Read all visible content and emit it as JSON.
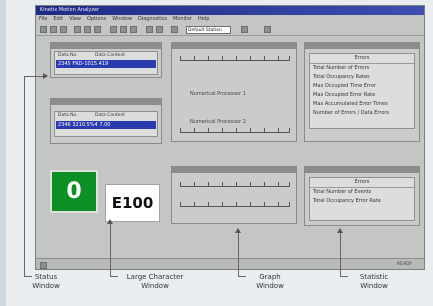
{
  "window": {
    "title": "Kinetix Motion Analyzer"
  },
  "menu": [
    "File",
    "Edit",
    "View",
    "Options",
    "Window",
    "Diagnostics",
    "Monitor",
    "Help"
  ],
  "toolbar": {
    "field_value": "Default Station"
  },
  "status_windows": [
    {
      "col1": "Data No.",
      "col2": "Data Content",
      "row": "2345  FRD-1015.419"
    },
    {
      "col1": "Data No.",
      "col2": "Data Content",
      "row": "2346  3210.5%4  7.00"
    }
  ],
  "graph_windows": [
    {
      "label_top": "Numerical Processor 1",
      "label_bottom": "Numerical Processor 2"
    }
  ],
  "statistics_top": {
    "header": "Errors",
    "items": [
      "Total Number of Errors",
      "Total Occupancy Rates",
      "Max Occupied Time Error",
      "Max Occupied Error Rate",
      "Max Accumulated Error Times",
      "Number of Errors / Data Errors"
    ]
  },
  "statistics_bottom": {
    "header": "Errors",
    "items": [
      "Total Number of Events",
      "Total Occupancy Error Rate"
    ]
  },
  "large_numeric": {
    "value": "0"
  },
  "large_character": {
    "value": "E100"
  },
  "status_bar": {
    "text": "READY"
  },
  "captions": {
    "status": "Status\nWindow",
    "large_character": "Large Character\nWindow",
    "graph": "Graph\nWindow",
    "statistics": "Statistic\nWindow"
  },
  "colors": {
    "accent": "#2a3bb0",
    "green": "#0c8f25",
    "title": "#1f2a83"
  }
}
